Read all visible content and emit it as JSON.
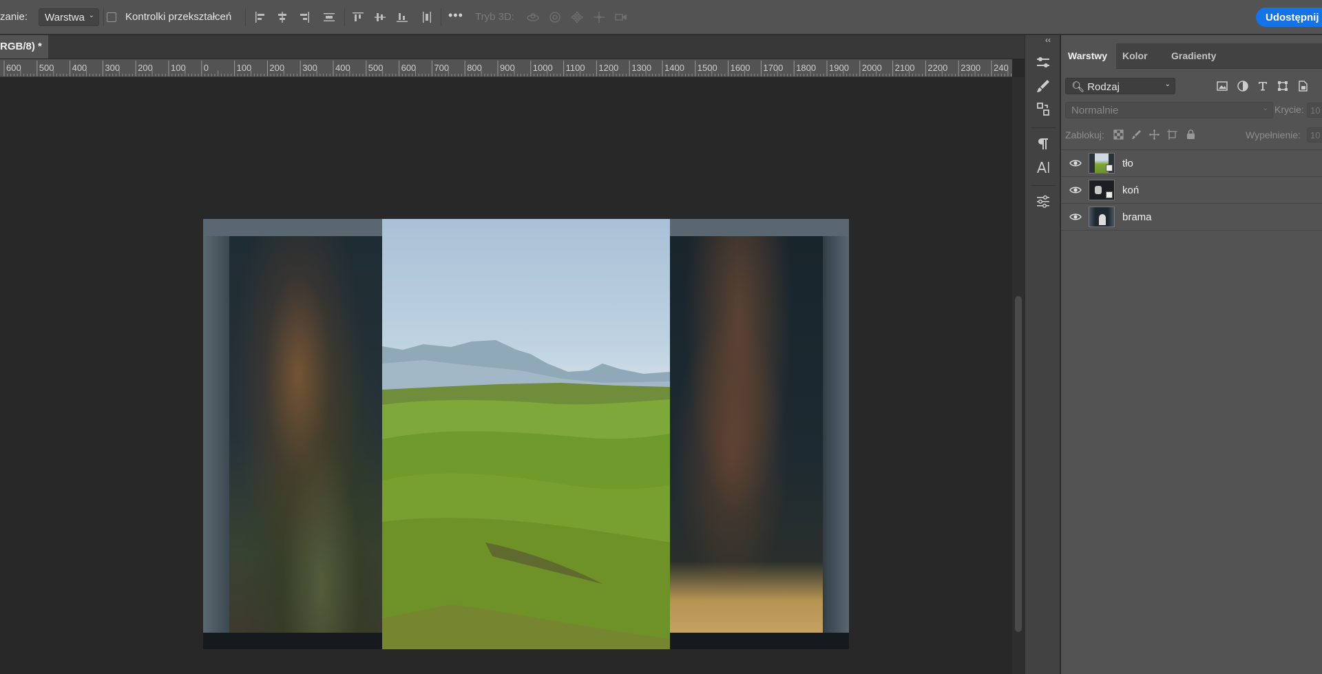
{
  "options_bar": {
    "select_label": "zanie:",
    "select_value": "Warstwa",
    "transform_controls_label": "Kontrolki przekształceń",
    "more": "•••",
    "mode_3d_label": "Tryb 3D:",
    "share_button": "Udostępnij"
  },
  "document": {
    "tab_title": "RGB/8) *"
  },
  "ruler": {
    "labels": [
      "600",
      "500",
      "400",
      "300",
      "200",
      "100",
      "0",
      "100",
      "200",
      "300",
      "400",
      "500",
      "600",
      "700",
      "800",
      "900",
      "1000",
      "1100",
      "1200",
      "1300",
      "1400",
      "1500",
      "1600",
      "1700",
      "1800",
      "1900",
      "2000",
      "2100",
      "2200",
      "2300",
      "240"
    ]
  },
  "panel": {
    "tabs": [
      "Warstwy",
      "Kolor",
      "Gradienty"
    ],
    "active_tab": "Warstwy",
    "filter_kind": "Rodzaj",
    "blend_mode": "Normalnie",
    "opacity_label": "Krycie:",
    "opacity_value": "10",
    "lock_label": "Zablokuj:",
    "fill_label": "Wypełnienie:",
    "fill_value": "10",
    "layers": [
      {
        "name": "tło",
        "visible": true
      },
      {
        "name": "koń",
        "visible": true
      },
      {
        "name": "brama",
        "visible": true
      }
    ]
  },
  "colors": {
    "accent": "#1473e6",
    "panel_bg": "#535353",
    "canvas_bg": "#282828"
  }
}
